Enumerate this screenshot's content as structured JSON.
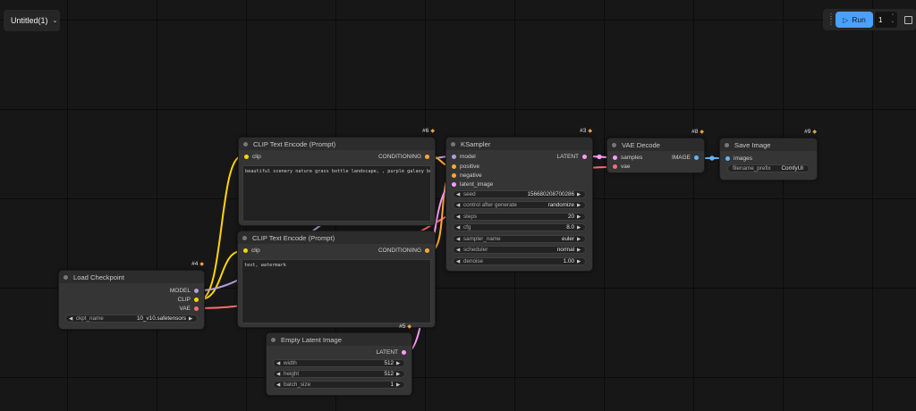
{
  "workflow": {
    "title": "Untitled(1)"
  },
  "toolbar": {
    "run_label": "Run",
    "batch_count": "1"
  },
  "colors": {
    "model": "#b39ddb",
    "clip": "#ffd500",
    "vae": "#ff6e6e",
    "conditioning": "#ffa931",
    "latent": "#ff9cf9",
    "image": "#64b5f6",
    "run": "#4aa1ff"
  },
  "nodes": {
    "load_checkpoint": {
      "id": "#4",
      "title": "Load Checkpoint",
      "outputs": [
        "MODEL",
        "CLIP",
        "VAE"
      ],
      "ckpt_label": "ckpt_name",
      "ckpt_value": "10_v10.safetensors"
    },
    "clip_pos": {
      "id": "#6",
      "title": "CLIP Text Encode (Prompt)",
      "input": "clip",
      "output": "CONDITIONING",
      "text": "beautiful scenery nature grass bottle landscape, , purple galaxy bottle,"
    },
    "clip_neg": {
      "id": "#7",
      "title": "CLIP Text Encode (Prompt)",
      "input": "clip",
      "output": "CONDITIONING",
      "text": "text, watermark"
    },
    "empty_latent": {
      "id": "#5",
      "title": "Empty Latent Image",
      "output": "LATENT",
      "widgets": [
        {
          "label": "width",
          "value": "512"
        },
        {
          "label": "height",
          "value": "512"
        },
        {
          "label": "batch_size",
          "value": "1"
        }
      ]
    },
    "ksampler": {
      "id": "#3",
      "title": "KSampler",
      "inputs": [
        "model",
        "positive",
        "negative",
        "latent_image"
      ],
      "output": "LATENT",
      "widgets": [
        {
          "label": "seed",
          "value": "156680208700286"
        },
        {
          "label": "control after generate",
          "value": "randomize"
        },
        {
          "label": "steps",
          "value": "20"
        },
        {
          "label": "cfg",
          "value": "8.0"
        },
        {
          "label": "sampler_name",
          "value": "euler"
        },
        {
          "label": "scheduler",
          "value": "normal"
        },
        {
          "label": "denoise",
          "value": "1.00"
        }
      ]
    },
    "vae_decode": {
      "id": "#8",
      "title": "VAE Decode",
      "inputs": [
        "samples",
        "vae"
      ],
      "output": "IMAGE"
    },
    "save_image": {
      "id": "#9",
      "title": "Save Image",
      "input": "images",
      "prefix_label": "filename_prefix",
      "prefix_value": "ComfyUI"
    }
  }
}
